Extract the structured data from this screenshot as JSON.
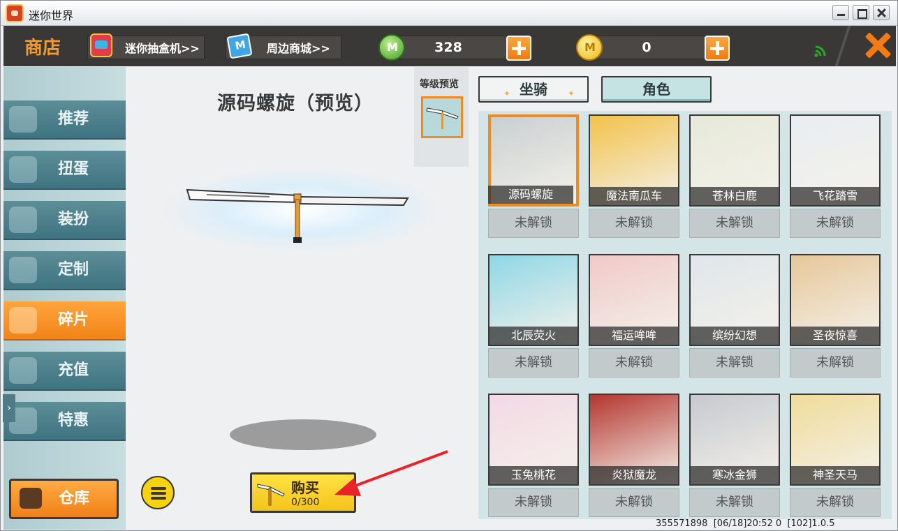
{
  "window": {
    "title": "迷你世界"
  },
  "topbar": {
    "shop_title": "商店",
    "blindbox_link": "迷你抽盒机>>",
    "mall_link": "周边商城>>",
    "mini_coin_value": "328",
    "gold_coin_value": "0"
  },
  "sidebar": {
    "items": [
      "推荐",
      "扭蛋",
      "装扮",
      "定制",
      "碎片",
      "充值",
      "特惠"
    ],
    "active": "碎片",
    "warehouse_label": "仓库",
    "expand_icon": "chevron-right-icon"
  },
  "preview": {
    "title": "源码螺旋（预览）",
    "level_preview_label": "等级预览",
    "buy_label": "购买",
    "buy_count": "0/300"
  },
  "tabs": {
    "mount": "坐骑",
    "role": "角色",
    "active": "坐骑"
  },
  "items": [
    {
      "name": "源码螺旋",
      "status": "未解锁",
      "color": "#c9cfd1",
      "selected": true
    },
    {
      "name": "魔法南瓜车",
      "status": "未解锁",
      "color": "#f2c24b"
    },
    {
      "name": "苍林白鹿",
      "status": "未解锁",
      "color": "#e6ead9"
    },
    {
      "name": "飞花踏雪",
      "status": "未解锁",
      "color": "#e9eef2"
    },
    {
      "name": "北辰荧火",
      "status": "未解锁",
      "color": "#8fd7e6"
    },
    {
      "name": "福运哞哞",
      "status": "未解锁",
      "color": "#f0c9c8"
    },
    {
      "name": "缤纷幻想",
      "status": "未解锁",
      "color": "#dfe6ea"
    },
    {
      "name": "圣夜惊喜",
      "status": "未解锁",
      "color": "#e6c79a"
    },
    {
      "name": "玉兔桃花",
      "status": "未解锁",
      "color": "#f3d9e5"
    },
    {
      "name": "炎狱魔龙",
      "status": "未解锁",
      "color": "#b4362f"
    },
    {
      "name": "寒冰金狮",
      "status": "未解锁",
      "color": "#c6c9cf"
    },
    {
      "name": "神圣天马",
      "status": "未解锁",
      "color": "#f0dc9a"
    }
  ],
  "status": {
    "id": "355571898",
    "time": "[06/18]20:52 0",
    "version": "[102]1.0.5"
  },
  "colors": {
    "accent": "#f28a1d",
    "dark": "#3a3836",
    "sidebar": "#4a7e8a",
    "buy": "#f9d20e"
  }
}
